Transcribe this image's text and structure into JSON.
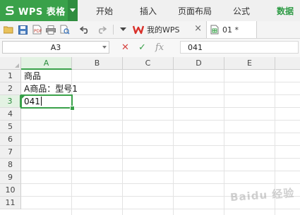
{
  "app": {
    "title": "WPS 表格",
    "brand_color": "#3aa14a",
    "logo_icon": "wps-s-logo-icon",
    "dropdown_icon": "chevron-down-icon"
  },
  "menu": {
    "items": [
      {
        "label": "开始",
        "active": false
      },
      {
        "label": "插入",
        "active": false
      },
      {
        "label": "页面布局",
        "active": false
      },
      {
        "label": "公式",
        "active": false
      },
      {
        "label": "数据",
        "active": true
      }
    ]
  },
  "toolbar": {
    "icons": [
      "open-folder-icon",
      "save-icon",
      "export-pdf-icon",
      "print-icon",
      "print-preview-icon",
      "undo-icon",
      "redo-icon",
      "more-dropdown-icon"
    ]
  },
  "tabs": [
    {
      "label": "我的WPS",
      "icon": "wps-logo-icon",
      "closable": true,
      "active": false,
      "close_glyph": "×"
    },
    {
      "label": "01 *",
      "icon": "spreadsheet-doc-icon",
      "closable": false,
      "active": true
    }
  ],
  "formula_bar": {
    "name_box": "A3",
    "cancel_glyph": "✕",
    "confirm_glyph": "✓",
    "fx_label": "fx",
    "formula_value": "041"
  },
  "sheet": {
    "columns": [
      "A",
      "B",
      "C",
      "D",
      "E"
    ],
    "rows": [
      "1",
      "2",
      "3",
      "4",
      "5",
      "6",
      "7",
      "8",
      "9",
      "10",
      "11"
    ],
    "selected_column": "A",
    "selected_row": "3",
    "cells": {
      "A1": "商品",
      "A2": "A商品：型号1",
      "A3": "041"
    }
  },
  "watermark": "Baidu 经验"
}
